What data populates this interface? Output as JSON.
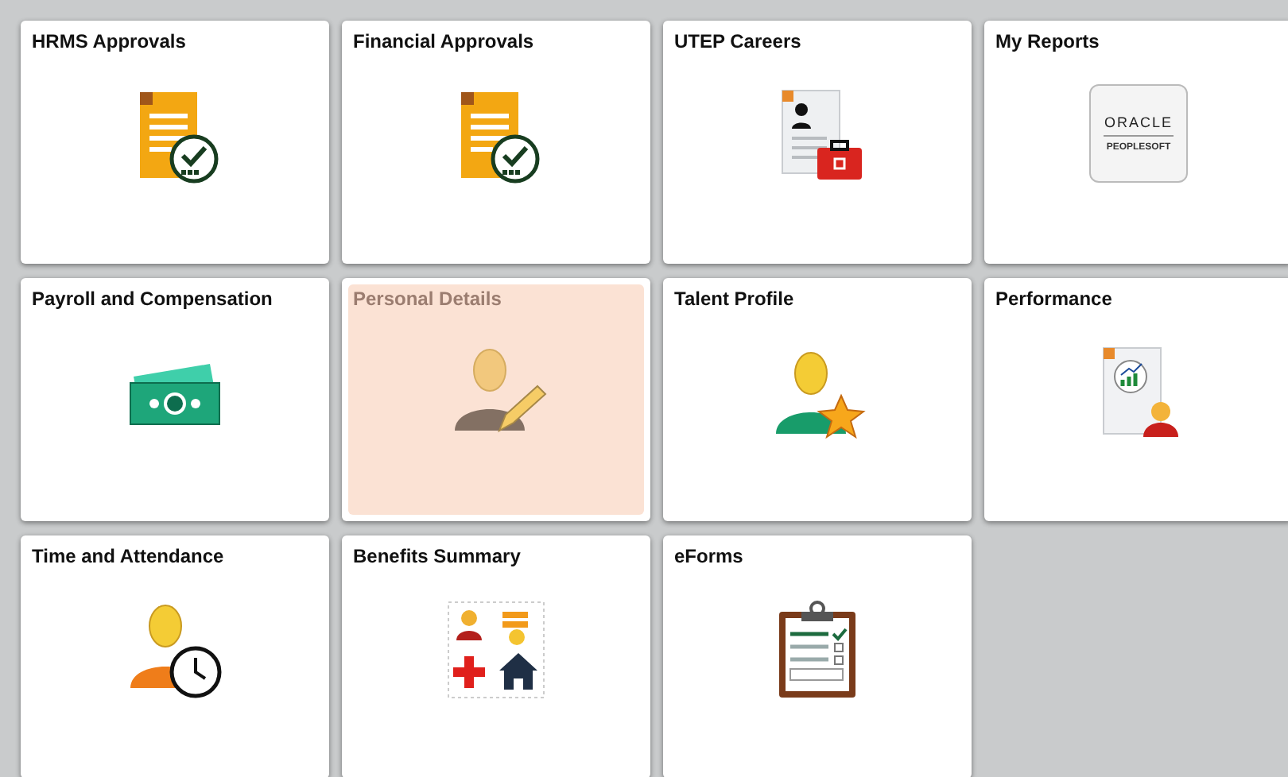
{
  "tiles": [
    {
      "title": "HRMS Approvals",
      "kind": "approval",
      "selected": false
    },
    {
      "title": "Financial Approvals",
      "kind": "approval",
      "selected": false
    },
    {
      "title": "UTEP Careers",
      "kind": "careers",
      "selected": false
    },
    {
      "title": "My Reports",
      "kind": "logo",
      "selected": false,
      "logo": {
        "name": "ORACLE",
        "product": "PEOPLESOFT"
      }
    },
    {
      "title": "Payroll and Compensation",
      "kind": "money",
      "selected": false
    },
    {
      "title": "Personal Details",
      "kind": "person-edit",
      "selected": true
    },
    {
      "title": "Talent Profile",
      "kind": "person-star",
      "selected": false
    },
    {
      "title": "Performance",
      "kind": "report",
      "selected": false
    },
    {
      "title": "Time and Attendance",
      "kind": "person-clock",
      "selected": false
    },
    {
      "title": "Benefits Summary",
      "kind": "benefits",
      "selected": false
    },
    {
      "title": "eForms",
      "kind": "clipboard",
      "selected": false
    }
  ]
}
